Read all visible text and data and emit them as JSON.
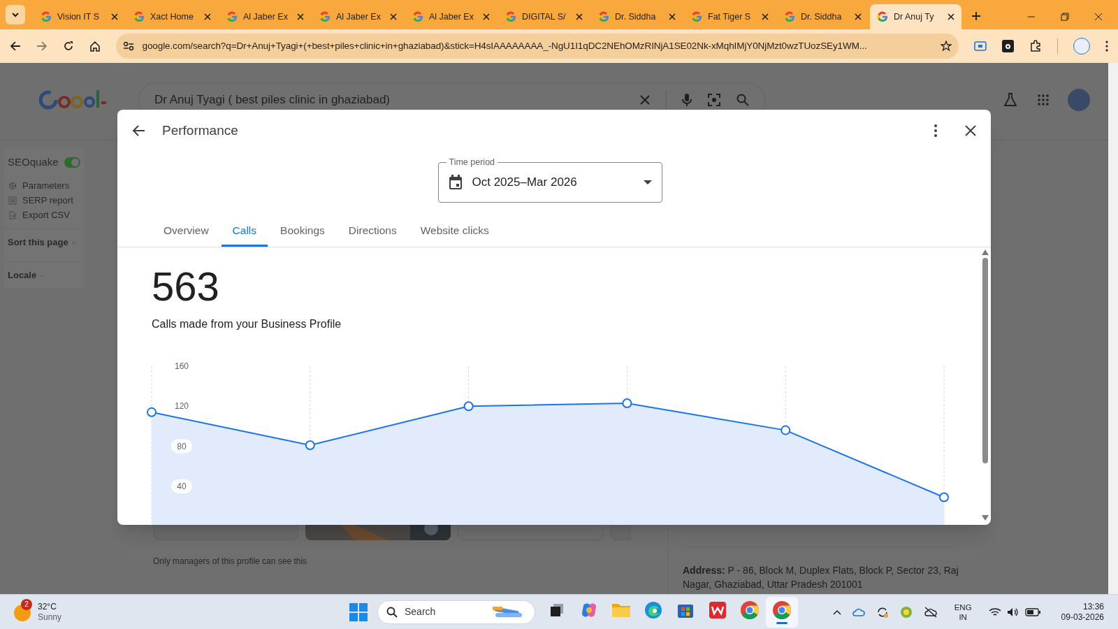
{
  "browser": {
    "tabs": [
      {
        "title": "Vision IT S",
        "selected": false
      },
      {
        "title": "Xact Home",
        "selected": false
      },
      {
        "title": "Al Jaber Ex",
        "selected": false
      },
      {
        "title": "Al Jaber Ex",
        "selected": false
      },
      {
        "title": "Al Jaber Ex",
        "selected": false
      },
      {
        "title": "DIGITAL S/",
        "selected": false
      },
      {
        "title": "Dr. Siddha",
        "selected": false
      },
      {
        "title": "Fat Tiger S",
        "selected": false
      },
      {
        "title": "Dr. Siddha",
        "selected": false
      },
      {
        "title": "Dr Anuj Ty",
        "selected": true
      }
    ],
    "address": "google.com/search?q=Dr+Anuj+Tyagi+(+best+piles+clinic+in+ghaziabad)&stick=H4sIAAAAAAAA_-NgU1I1qDC2NEhOMzRINjA1SE02Nk-xMqhIMjY0NjMzt0wzTUozSEy1WM..."
  },
  "google_page": {
    "query": "Dr Anuj Tyagi ( best piles clinic in ghaziabad)",
    "sidebar": {
      "title": "SEOquake",
      "enabled": true,
      "links": [
        {
          "kind": "gear",
          "label": "Parameters"
        },
        {
          "kind": "list",
          "label": "SERP report"
        },
        {
          "kind": "export",
          "label": "Export CSV"
        }
      ],
      "sections": [
        "Sort this page",
        "Locale"
      ]
    },
    "note": "Only managers of this profile can see this",
    "address": "**Address:** P - 86, Block M, Duplex Flats, Block P, Sector 23, Raj Nagar, Ghaziabad, Uttar Pradesh 201001"
  },
  "dialog": {
    "title": "Performance",
    "time_period": {
      "label": "Time period",
      "value": "Oct 2025–Mar 2026"
    },
    "tabs": [
      {
        "label": "Overview",
        "selected": false
      },
      {
        "label": "Calls",
        "selected": true
      },
      {
        "label": "Bookings",
        "selected": false
      },
      {
        "label": "Directions",
        "selected": false
      },
      {
        "label": "Website clicks",
        "selected": false
      }
    ],
    "metric": "563",
    "metric_caption": "Calls made from your Business Profile",
    "chart_data": {
      "type": "area",
      "grid": true,
      "ylim": [
        0,
        160
      ],
      "yticks": [
        40,
        80,
        120,
        160
      ],
      "series": [
        {
          "color": "#1a73e8",
          "values": [
            114,
            81,
            120,
            123,
            96,
            29
          ]
        }
      ]
    }
  },
  "taskbar": {
    "weather": {
      "badge": "2",
      "temperature": "32°C",
      "condition": "Sunny"
    },
    "search_placeholder": "Search",
    "apps": [
      {
        "kind": "taskview",
        "active": false
      },
      {
        "kind": "copilot",
        "active": false
      },
      {
        "kind": "folder",
        "active": false
      },
      {
        "kind": "edge",
        "active": false
      },
      {
        "kind": "store",
        "active": false
      },
      {
        "kind": "office",
        "active": false
      },
      {
        "kind": "chrome",
        "active": false
      },
      {
        "kind": "chrome",
        "active": true
      }
    ],
    "language": "ENG",
    "region": "IN",
    "time": "13:36",
    "date": "09-03-2026"
  }
}
